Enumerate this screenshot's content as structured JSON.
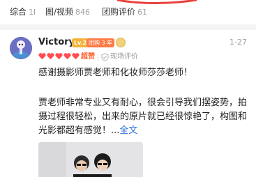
{
  "filters": [
    {
      "label": "综合",
      "count": "1l"
    },
    {
      "label": "图/视频",
      "count": "846"
    },
    {
      "label": "团购评价",
      "count": "61"
    }
  ],
  "review": {
    "username": "Victory",
    "level_badge": "Lv.2",
    "group_badge": "团购 3 年",
    "date": "1-27",
    "rating_text": "超赞",
    "rating_stars": 5,
    "verify_text": "现场评价",
    "line1": "感谢摄影师贾老师和化妆师莎莎老师！",
    "para2": "贾老师非常专业又有耐心，很会引导我们摆姿势，拍摄过程很轻松，出来的原片就已经很惊艳了，构图和光影都超有感觉！",
    "ellipsis": "...",
    "expand_label": "全文"
  },
  "colors": {
    "accent_red": "#e8413c",
    "level_badge": "#f2b33a",
    "group_badge": "#ff7a45",
    "link": "#2a6fd6"
  },
  "icons": [
    "heart-icon",
    "verify-icon",
    "medal-icon"
  ]
}
